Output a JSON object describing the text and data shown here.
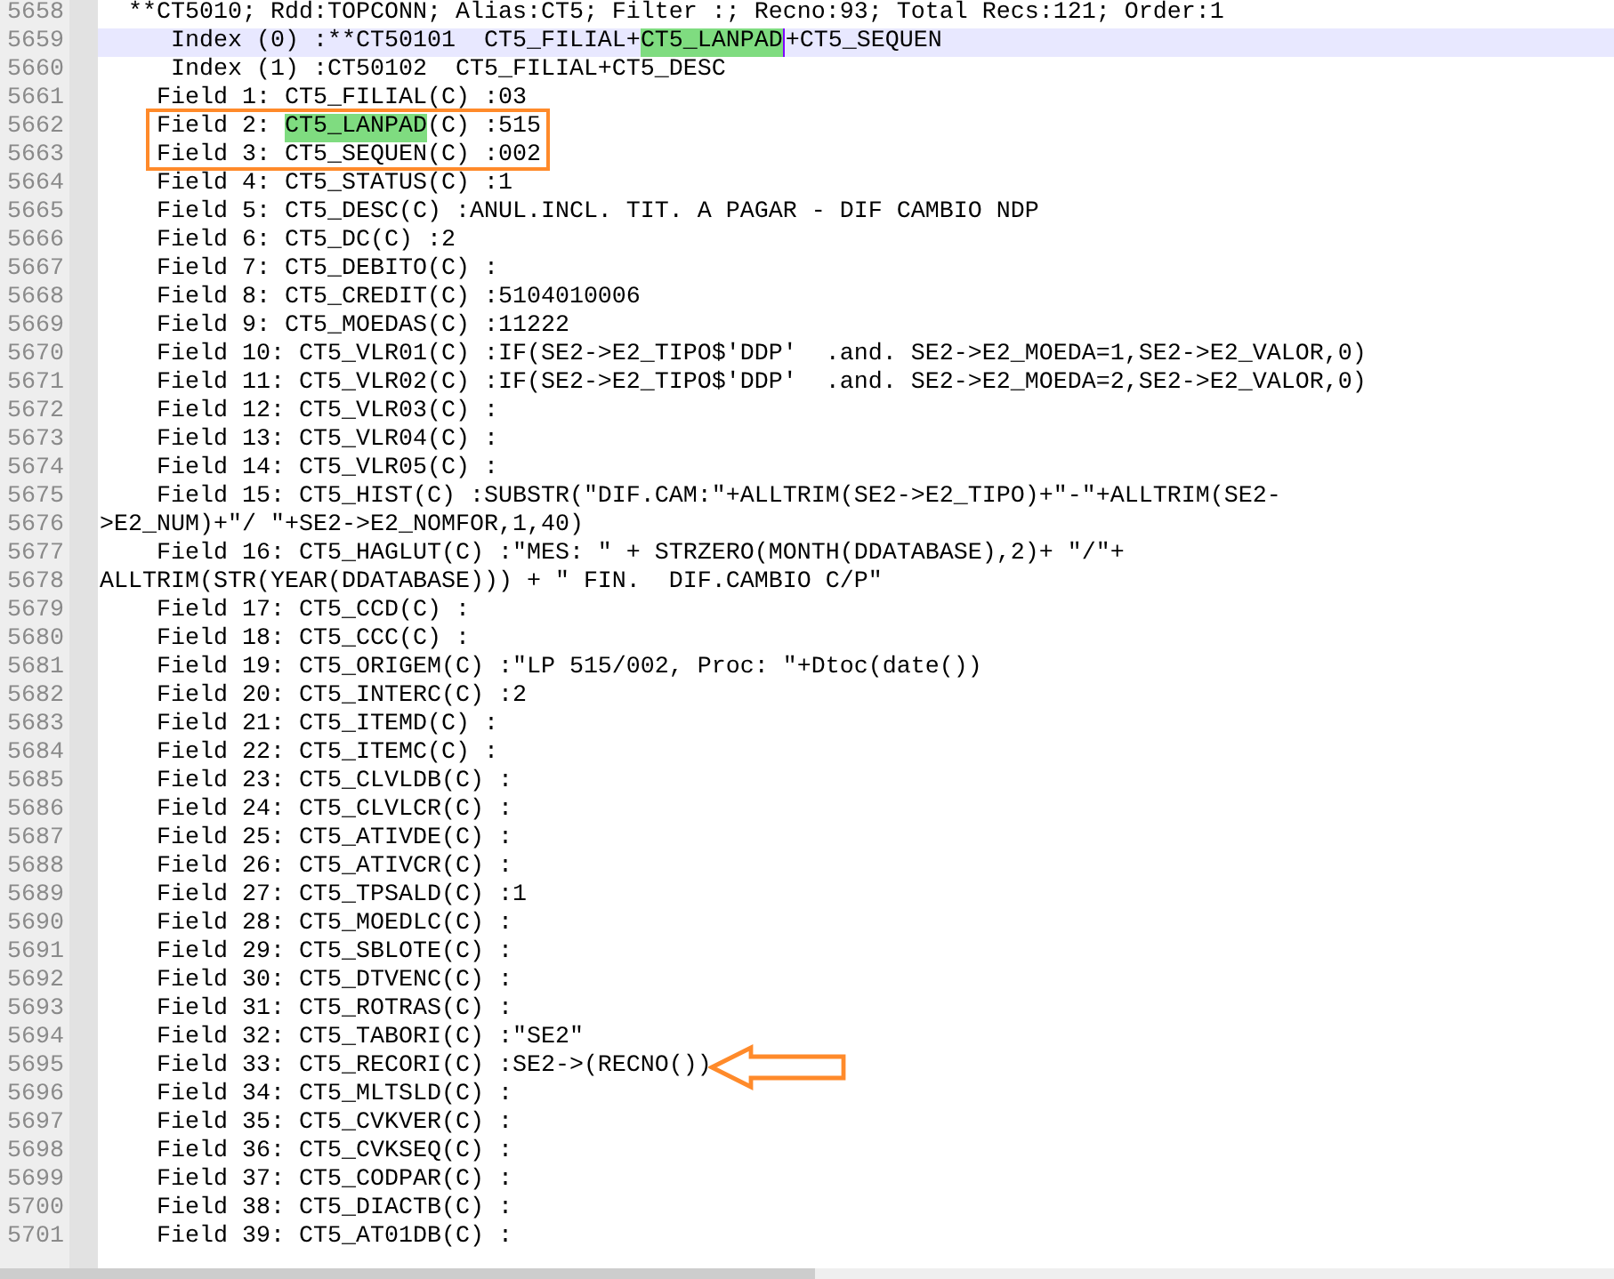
{
  "editor": {
    "lines": [
      {
        "number": "5658",
        "current": false,
        "text": "  **CT5010; Rdd:TOPCONN; Alias:CT5; Filter :; Recno:93; Total Recs:121; Order:1"
      },
      {
        "number": "5659",
        "current": true,
        "parts": [
          {
            "text": "     Index (0) :**CT50101  CT5_FILIAL+",
            "highlighted": false
          },
          {
            "text": "CT5_LANPAD",
            "highlighted": true
          },
          {
            "text": "+CT5_SEQUEN",
            "highlighted": false
          }
        ]
      },
      {
        "number": "5660",
        "current": false,
        "text": "     Index (1) :CT50102  CT5_FILIAL+CT5_DESC"
      },
      {
        "number": "5661",
        "current": false,
        "text": "    Field 1: CT5_FILIAL(C) :03"
      },
      {
        "number": "5662",
        "current": false,
        "parts": [
          {
            "text": "    Field 2: ",
            "highlighted": false
          },
          {
            "text": "CT5_LANPAD",
            "highlighted": true
          },
          {
            "text": "(C) :515",
            "highlighted": false
          }
        ]
      },
      {
        "number": "5663",
        "current": false,
        "text": "    Field 3: CT5_SEQUEN(C) :002"
      },
      {
        "number": "5664",
        "current": false,
        "text": "    Field 4: CT5_STATUS(C) :1"
      },
      {
        "number": "5665",
        "current": false,
        "text": "    Field 5: CT5_DESC(C) :ANUL.INCL. TIT. A PAGAR - DIF CAMBIO NDP"
      },
      {
        "number": "5666",
        "current": false,
        "text": "    Field 6: CT5_DC(C) :2"
      },
      {
        "number": "5667",
        "current": false,
        "text": "    Field 7: CT5_DEBITO(C) :"
      },
      {
        "number": "5668",
        "current": false,
        "text": "    Field 8: CT5_CREDIT(C) :5104010006"
      },
      {
        "number": "5669",
        "current": false,
        "text": "    Field 9: CT5_MOEDAS(C) :11222"
      },
      {
        "number": "5670",
        "current": false,
        "text": "    Field 10: CT5_VLR01(C) :IF(SE2->E2_TIPO$'DDP'  .and. SE2->E2_MOEDA=1,SE2->E2_VALOR,0)"
      },
      {
        "number": "5671",
        "current": false,
        "text": "    Field 11: CT5_VLR02(C) :IF(SE2->E2_TIPO$'DDP'  .and. SE2->E2_MOEDA=2,SE2->E2_VALOR,0)"
      },
      {
        "number": "5672",
        "current": false,
        "text": "    Field 12: CT5_VLR03(C) :"
      },
      {
        "number": "5673",
        "current": false,
        "text": "    Field 13: CT5_VLR04(C) :"
      },
      {
        "number": "5674",
        "current": false,
        "text": "    Field 14: CT5_VLR05(C) :"
      },
      {
        "number": "5675",
        "current": false,
        "text": "    Field 15: CT5_HIST(C) :SUBSTR(\"DIF.CAM:\"+ALLTRIM(SE2->E2_TIPO)+\"-\"+ALLTRIM(SE2-"
      },
      {
        "number": "5676",
        "current": false,
        "text": ">E2_NUM)+\"/ \"+SE2->E2_NOMFOR,1,40)"
      },
      {
        "number": "5677",
        "current": false,
        "text": "    Field 16: CT5_HAGLUT(C) :\"MES: \" + STRZERO(MONTH(DDATABASE),2)+ \"/\"+"
      },
      {
        "number": "5678",
        "current": false,
        "text": "ALLTRIM(STR(YEAR(DDATABASE))) + \" FIN.  DIF.CAMBIO C/P\""
      },
      {
        "number": "5679",
        "current": false,
        "text": "    Field 17: CT5_CCD(C) :"
      },
      {
        "number": "5680",
        "current": false,
        "text": "    Field 18: CT5_CCC(C) :"
      },
      {
        "number": "5681",
        "current": false,
        "text": "    Field 19: CT5_ORIGEM(C) :\"LP 515/002, Proc: \"+Dtoc(date())"
      },
      {
        "number": "5682",
        "current": false,
        "text": "    Field 20: CT5_INTERC(C) :2"
      },
      {
        "number": "5683",
        "current": false,
        "text": "    Field 21: CT5_ITEMD(C) :"
      },
      {
        "number": "5684",
        "current": false,
        "text": "    Field 22: CT5_ITEMC(C) :"
      },
      {
        "number": "5685",
        "current": false,
        "text": "    Field 23: CT5_CLVLDB(C) :"
      },
      {
        "number": "5686",
        "current": false,
        "text": "    Field 24: CT5_CLVLCR(C) :"
      },
      {
        "number": "5687",
        "current": false,
        "text": "    Field 25: CT5_ATIVDE(C) :"
      },
      {
        "number": "5688",
        "current": false,
        "text": "    Field 26: CT5_ATIVCR(C) :"
      },
      {
        "number": "5689",
        "current": false,
        "text": "    Field 27: CT5_TPSALD(C) :1"
      },
      {
        "number": "5690",
        "current": false,
        "text": "    Field 28: CT5_MOEDLC(C) :"
      },
      {
        "number": "5691",
        "current": false,
        "text": "    Field 29: CT5_SBLOTE(C) :"
      },
      {
        "number": "5692",
        "current": false,
        "text": "    Field 30: CT5_DTVENC(C) :"
      },
      {
        "number": "5693",
        "current": false,
        "text": "    Field 31: CT5_ROTRAS(C) :"
      },
      {
        "number": "5694",
        "current": false,
        "text": "    Field 32: CT5_TABORI(C) :\"SE2\""
      },
      {
        "number": "5695",
        "current": false,
        "text": "    Field 33: CT5_RECORI(C) :SE2->(RECNO())"
      },
      {
        "number": "5696",
        "current": false,
        "text": "    Field 34: CT5_MLTSLD(C) :"
      },
      {
        "number": "5697",
        "current": false,
        "text": "    Field 35: CT5_CVKVER(C) :"
      },
      {
        "number": "5698",
        "current": false,
        "text": "    Field 36: CT5_CVKSEQ(C) :"
      },
      {
        "number": "5699",
        "current": false,
        "text": "    Field 37: CT5_CODPAR(C) :"
      },
      {
        "number": "5700",
        "current": false,
        "text": "    Field 38: CT5_DIACTB(C) :"
      },
      {
        "number": "5701",
        "current": false,
        "text": "    Field 39: CT5_AT01DB(C) :"
      }
    ]
  },
  "annotations": [
    {
      "kind": "box"
    },
    {
      "kind": "arrow"
    }
  ]
}
